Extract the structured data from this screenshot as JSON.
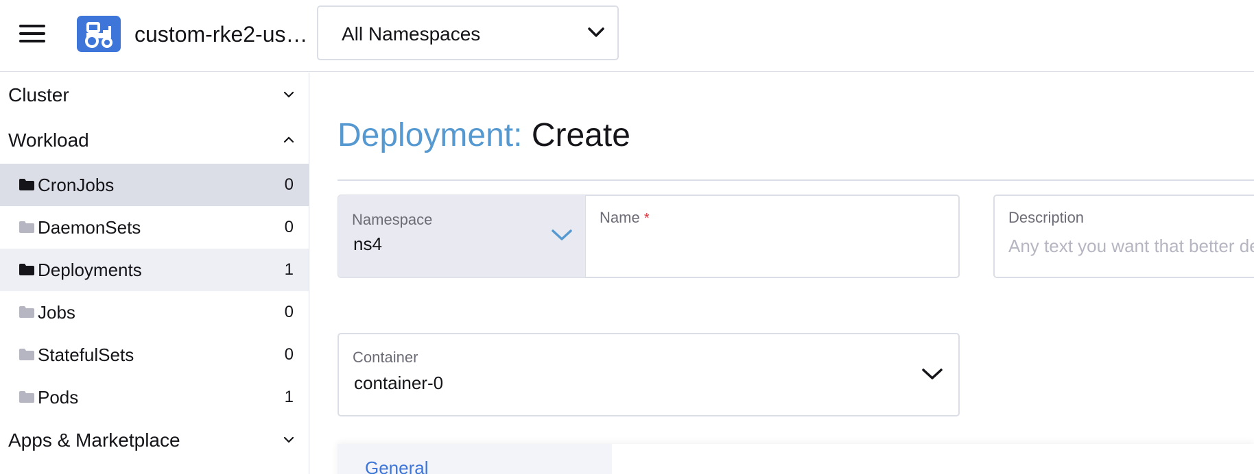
{
  "header": {
    "cluster_name": "custom-rke2-us…",
    "namespace_filter": "All Namespaces"
  },
  "sidebar": {
    "groups": [
      {
        "label": "Cluster",
        "expanded": false
      },
      {
        "label": "Workload",
        "expanded": true
      },
      {
        "label": "Apps & Marketplace",
        "expanded": false
      }
    ],
    "items": [
      {
        "label": "CronJobs",
        "count": "0"
      },
      {
        "label": "DaemonSets",
        "count": "0"
      },
      {
        "label": "Deployments",
        "count": "1"
      },
      {
        "label": "Jobs",
        "count": "0"
      },
      {
        "label": "StatefulSets",
        "count": "0"
      },
      {
        "label": "Pods",
        "count": "1"
      }
    ]
  },
  "main": {
    "title_resource": "Deployment:",
    "title_action": "Create",
    "namespace": {
      "label": "Namespace",
      "value": "ns4"
    },
    "name": {
      "label": "Name",
      "required_mark": "*",
      "value": ""
    },
    "description": {
      "label": "Description",
      "placeholder": "Any text you want that better describes this resource"
    },
    "container": {
      "label": "Container",
      "value": "container-0"
    },
    "tabs": [
      {
        "label": "General"
      }
    ]
  },
  "colors": {
    "accent": "#3d75d9",
    "title_link": "#5699d1",
    "required": "#e0333c",
    "active_row": "#dcdee7",
    "border": "#dcdee7"
  },
  "icons": {
    "menu": "hamburger-icon",
    "logo": "tractor-icon",
    "folder": "folder-icon",
    "dropdown": "chevron-down-icon",
    "collapse": "chevron-up-icon"
  }
}
